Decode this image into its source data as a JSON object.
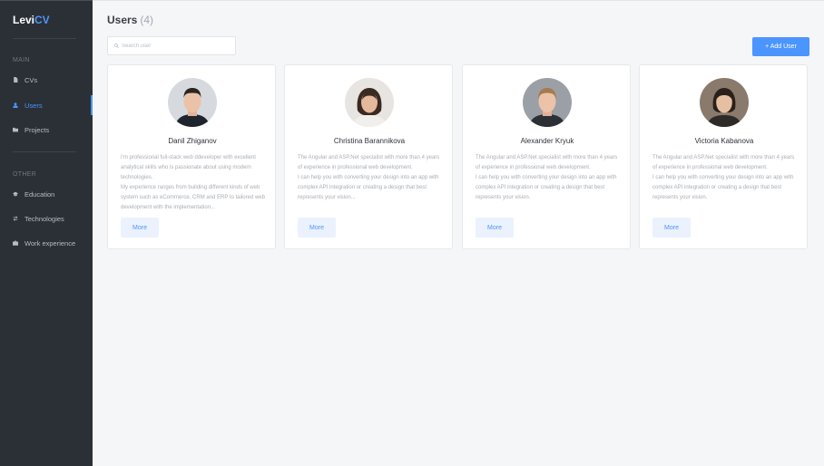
{
  "brand": {
    "prefix": "Levi",
    "accent": "CV",
    "accent_color": "#4b95ff"
  },
  "sidebar": {
    "sections": [
      {
        "label": "MAIN",
        "items": [
          {
            "label": "CVs",
            "icon": "document-icon",
            "active": false
          },
          {
            "label": "Users",
            "icon": "user-icon",
            "active": true
          },
          {
            "label": "Projects",
            "icon": "folder-icon",
            "active": false
          }
        ]
      },
      {
        "label": "OTHER",
        "items": [
          {
            "label": "Education",
            "icon": "graduation-cap-icon",
            "active": false
          },
          {
            "label": "Technologies",
            "icon": "swap-arrows-icon",
            "active": false
          },
          {
            "label": "Work experience",
            "icon": "briefcase-icon",
            "active": false
          }
        ]
      }
    ]
  },
  "header": {
    "title": "Users",
    "count": "(4)"
  },
  "search": {
    "placeholder": "Search user",
    "icon": "search-icon"
  },
  "toolbar": {
    "add_label": "+ Add User"
  },
  "users": [
    {
      "name": "Danil Zhiganov",
      "desc": [
        "I'm professional full-stack web ddeveloper with excellent analytical skills who is passionate about using modern technologies.",
        "My experience ranges from building different kinds of web system such as eCommerce, CRM and ERP to tailored web development with the implementation..."
      ],
      "more_label": "More"
    },
    {
      "name": "Christina Barannikova",
      "desc": [
        "The Angular and ASP.Net specialist with more than 4 years of experience in professional web development.",
        "I can help you with converting your design into an app with complex API integration or creating a design that best represents your vision..."
      ],
      "more_label": "More"
    },
    {
      "name": "Alexander Kryuk",
      "desc": [
        "The Angular and ASP.Net specialist with more than 4 years of experience in professional web development.",
        "I can help you with converting your design into an app with complex API integration or creating a design that best represents your vision."
      ],
      "more_label": "More"
    },
    {
      "name": "Victoria Kabanova",
      "desc": [
        "The Angular and ASP.Net specialist with more than 4 years of experience in professional web development.",
        "I can help you with converting your design into an app with complex API integration or creating a design that best represents your vision."
      ],
      "more_label": "More"
    }
  ],
  "colors": {
    "sidebar_bg": "#2b3036",
    "primary": "#4b95ff",
    "page_bg": "#f5f6f8",
    "card_bg": "#ffffff"
  }
}
